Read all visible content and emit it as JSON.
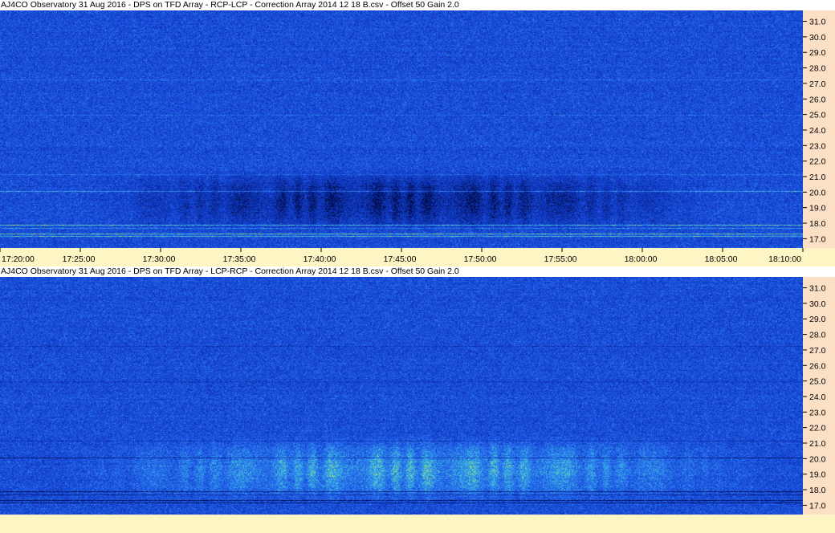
{
  "panels": [
    {
      "title": "AJ4CO Observatory 31 Aug 2016  -  DPS on TFD Array  -  RCP-LCP  -  Correction Array 2014 12 18 B.csv  -  Offset 50  Gain 2.0",
      "polarization": "RCP-LCP",
      "time_labels_shown": true
    },
    {
      "title": "AJ4CO Observatory 31 Aug 2016  -  DPS on TFD Array  -  LCP-RCP  -  Correction Array 2014 12 18 B.csv  -  Offset 50  Gain 2.0",
      "polarization": "LCP-RCP",
      "time_labels_shown": false
    }
  ],
  "chart_data": [
    {
      "type": "heatmap",
      "title": "AJ4CO Observatory 31 Aug 2016  -  DPS on TFD Array  -  RCP-LCP  -  Correction Array 2014 12 18 B.csv  -  Offset 50  Gain 2.0",
      "xlabel": "",
      "ylabel": "",
      "x_tick_labels": [
        "17:20:00",
        "17:25:00",
        "17:30:00",
        "17:35:00",
        "17:40:00",
        "17:45:00",
        "17:50:00",
        "17:55:00",
        "18:00:00",
        "18:05:00",
        "18:10:00"
      ],
      "xlim": [
        "17:20:00",
        "18:10:00"
      ],
      "y_tick_labels": [
        "31.0",
        "30.0",
        "29.0",
        "28.0",
        "27.0",
        "26.0",
        "25.0",
        "24.0",
        "23.0",
        "22.0",
        "21.0",
        "20.0",
        "19.0",
        "18.0",
        "17.0"
      ],
      "ylim": [
        16.4,
        31.7
      ],
      "colormap": [
        "#00063a",
        "#0a2a9e",
        "#1544d6",
        "#2a74ee",
        "#3ac0e0",
        "#c8ec50",
        "#f0d020"
      ],
      "features": [
        {
          "kind": "dark-emission",
          "time_start": "17:25:00",
          "time_end": "18:05:00",
          "freq_low": 17.0,
          "freq_high": 21.5,
          "peak_freq": 20.0
        }
      ]
    },
    {
      "type": "heatmap",
      "title": "AJ4CO Observatory 31 Aug 2016  -  DPS on TFD Array  -  LCP-RCP  -  Correction Array 2014 12 18 B.csv  -  Offset 50  Gain 2.0",
      "xlabel": "",
      "ylabel": "",
      "x_tick_labels": [],
      "xlim": [
        "17:20:00",
        "18:10:00"
      ],
      "y_tick_labels": [
        "31.0",
        "30.0",
        "29.0",
        "28.0",
        "27.0",
        "26.0",
        "25.0",
        "24.0",
        "23.0",
        "22.0",
        "21.0",
        "20.0",
        "19.0",
        "18.0",
        "17.0"
      ],
      "ylim": [
        16.4,
        31.7
      ],
      "colormap": [
        "#00063a",
        "#0a2a9e",
        "#1544d6",
        "#2a74ee",
        "#3ac0e0",
        "#c8ec50",
        "#f0d020"
      ],
      "features": [
        {
          "kind": "bright-emission",
          "time_start": "17:24:00",
          "time_end": "18:08:00",
          "freq_low": 16.6,
          "freq_high": 21.5,
          "peak_freq": 20.0
        }
      ]
    }
  ]
}
